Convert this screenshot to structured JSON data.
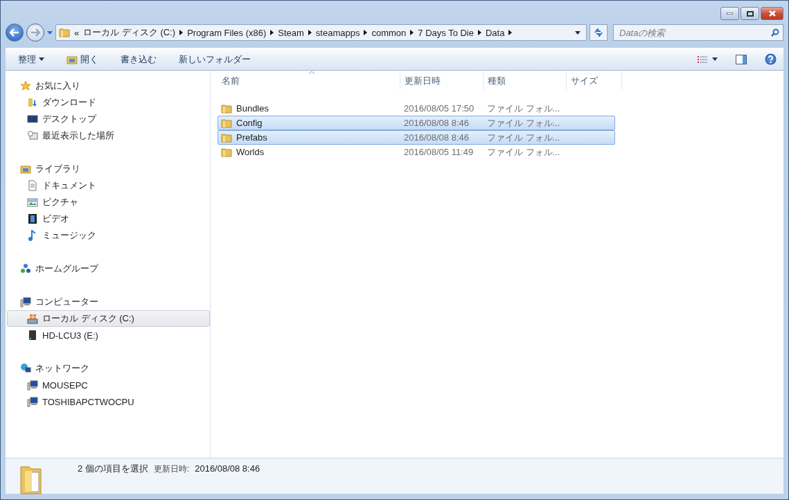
{
  "breadcrumb": {
    "overflow": "«",
    "parts": [
      "ローカル ディスク (C:)",
      "Program Files (x86)",
      "Steam",
      "steamapps",
      "common",
      "7 Days To Die",
      "Data"
    ]
  },
  "search": {
    "placeholder": "Dataの検索"
  },
  "toolbar": [
    {
      "label": "整理",
      "kind": "menu"
    },
    {
      "label": "開く",
      "kind": "open"
    },
    {
      "label": "書き込む",
      "kind": "plain"
    },
    {
      "label": "新しいフォルダー",
      "kind": "plain"
    }
  ],
  "sidebar": {
    "groups": [
      {
        "label": "お気に入り",
        "kind": "star",
        "children": [
          {
            "label": "ダウンロード",
            "kind": "download",
            "selected": false
          },
          {
            "label": "デスクトップ",
            "kind": "desktop",
            "selected": false
          },
          {
            "label": "最近表示した場所",
            "kind": "recent",
            "selected": false
          }
        ]
      },
      {
        "label": "ライブラリ",
        "kind": "library",
        "children": [
          {
            "label": "ドキュメント",
            "kind": "document",
            "selected": false
          },
          {
            "label": "ピクチャ",
            "kind": "picture",
            "selected": false
          },
          {
            "label": "ビデオ",
            "kind": "video",
            "selected": false
          },
          {
            "label": "ミュージック",
            "kind": "music",
            "selected": false
          }
        ]
      },
      {
        "label": "ホームグループ",
        "kind": "homegroup"
      },
      {
        "label": "コンピューター",
        "kind": "computer",
        "children": [
          {
            "label": "ローカル ディスク (C:)",
            "kind": "systemdrive",
            "selected": true
          },
          {
            "label": "HD-LCU3 (E:)",
            "kind": "externaldrive",
            "selected": false
          }
        ]
      },
      {
        "label": "ネットワーク",
        "kind": "network",
        "children": [
          {
            "label": "MOUSEPC",
            "kind": "computer",
            "selected": false
          },
          {
            "label": "TOSHIBAPCTWOCPU",
            "kind": "computer",
            "selected": false
          }
        ]
      }
    ]
  },
  "table": {
    "columns": [
      {
        "label": "名前",
        "sorted": true
      },
      {
        "label": "更新日時",
        "sorted": false
      },
      {
        "label": "種類",
        "sorted": false
      },
      {
        "label": "サイズ",
        "sorted": false
      }
    ],
    "rows": [
      {
        "name": "Bundles",
        "modified": "2016/08/05 17:50",
        "type": "ファイル フォル...",
        "selected": false
      },
      {
        "name": "Config",
        "modified": "2016/08/08 8:46",
        "type": "ファイル フォル...",
        "selected": true
      },
      {
        "name": "Prefabs",
        "modified": "2016/08/08 8:46",
        "type": "ファイル フォル...",
        "selected": true
      },
      {
        "name": "Worlds",
        "modified": "2016/08/05 11:49",
        "type": "ファイル フォル...",
        "selected": false
      }
    ]
  },
  "status_bar": {
    "selection": "2 個の項目を選択",
    "detail_label": "更新日時:",
    "detail_value": "2016/08/08 8:46"
  }
}
